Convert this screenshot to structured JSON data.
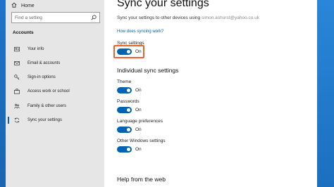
{
  "sidebar": {
    "home_label": "Home",
    "search_placeholder": "Find a setting",
    "section_title": "Accounts",
    "items": [
      {
        "label": "Your info",
        "icon": "person-card-icon"
      },
      {
        "label": "Email & accounts",
        "icon": "mail-icon"
      },
      {
        "label": "Sign-in options",
        "icon": "key-icon"
      },
      {
        "label": "Access work or school",
        "icon": "briefcase-icon"
      },
      {
        "label": "Family & other users",
        "icon": "people-icon"
      },
      {
        "label": "Sync your settings",
        "icon": "sync-icon",
        "active": true
      }
    ]
  },
  "main": {
    "title": "Sync your settings",
    "description": "Sync your settings to other devices using",
    "email": "simon.ashurst@yahoo.co.uk",
    "link": "How does syncing work?",
    "sync_settings": {
      "label": "Sync settings",
      "state": "On"
    },
    "individual_heading": "Individual sync settings",
    "individual": [
      {
        "label": "Theme",
        "state": "On"
      },
      {
        "label": "Passwords",
        "state": "On"
      },
      {
        "label": "Language preferences",
        "state": "On"
      },
      {
        "label": "Other Windows settings",
        "state": "On"
      }
    ],
    "help_heading": "Help from the web"
  },
  "colors": {
    "accent": "#0063b1",
    "highlight": "#e8632a",
    "sidebar_bg": "#e6e6e6"
  }
}
